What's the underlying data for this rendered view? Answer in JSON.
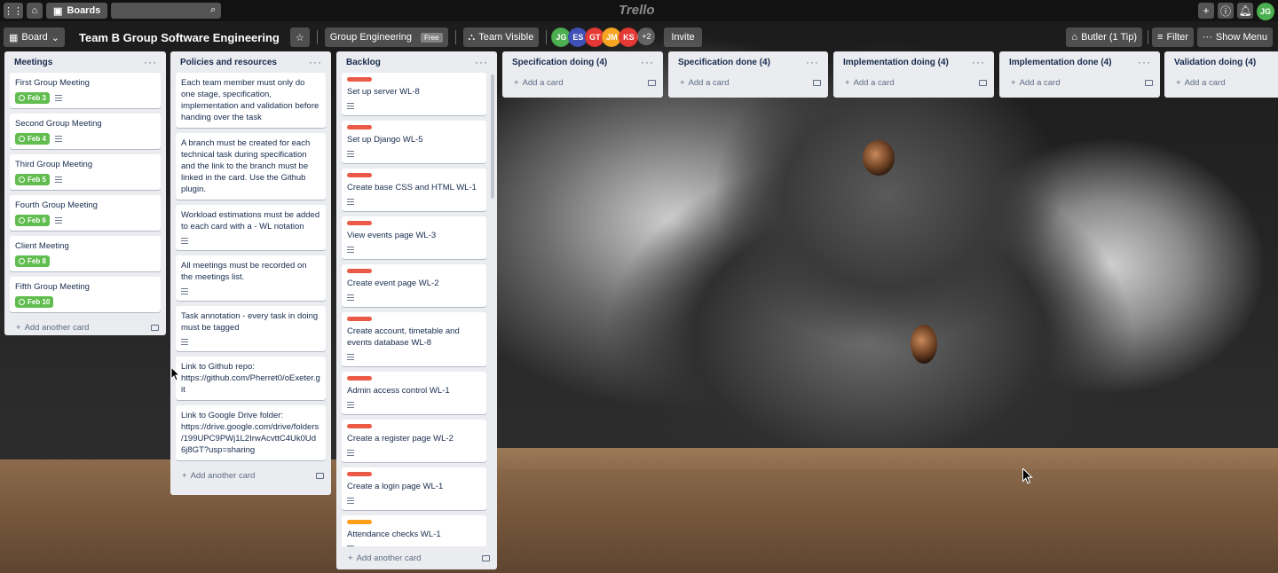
{
  "topbar": {
    "boards_label": "Boards",
    "logo": "Trello",
    "user_initials": "JG"
  },
  "header": {
    "view_label": "Board",
    "board_title": "Team B Group Software Engineering",
    "team_label": "Group Engineering",
    "team_plan": "Free",
    "visibility_label": "Team Visible",
    "members": [
      {
        "initials": "JG",
        "color": "#4caf50"
      },
      {
        "initials": "ES",
        "color": "#3f51b5"
      },
      {
        "initials": "GT",
        "color": "#e53935"
      },
      {
        "initials": "JM",
        "color": "#f6a623"
      },
      {
        "initials": "KS",
        "color": "#e53935"
      }
    ],
    "more_members": "+2",
    "invite_label": "Invite",
    "butler_label": "Butler (1 Tip)",
    "filter_label": "Filter",
    "show_menu_label": "Show Menu"
  },
  "lists": {
    "meetings": {
      "title": "Meetings",
      "add_label": "Add another card",
      "cards": [
        {
          "title": "First Group Meeting",
          "due": "Feb 3"
        },
        {
          "title": "Second Group Meeting",
          "due": "Feb 4"
        },
        {
          "title": "Third Group Meeting",
          "due": "Feb 5"
        },
        {
          "title": "Fourth Group Meeting",
          "due": "Feb 6"
        },
        {
          "title": "Client Meeting",
          "due": "Feb 8"
        },
        {
          "title": "Fifth Group Meeting",
          "due": "Feb 10"
        }
      ]
    },
    "policies": {
      "title": "Policies and resources",
      "add_label": "Add another card",
      "cards": [
        {
          "title": "Each team member must only do one stage, specification, implementation and validation before handing over the task"
        },
        {
          "title": "A branch must be created for each technical task during specification and the link to the branch must be linked in the card. Use the Github plugin."
        },
        {
          "title": "Workload estimations must be added to each card with a - WL notation"
        },
        {
          "title": "All meetings must be recorded on the meetings list."
        },
        {
          "title": "Task annotation - every task in doing must be tagged"
        },
        {
          "title": "Link to Github repo: https://github.com/Pherret0/oExeter.git"
        },
        {
          "title": "Link to Google Drive folder: https://drive.google.com/drive/folders/199UPC9PWj1L2IrwAcvttC4Uk0Ud6j8GT?usp=sharing"
        }
      ]
    },
    "backlog": {
      "title": "Backlog",
      "add_label": "Add another card",
      "cards": [
        {
          "title": "Set up server WL-8",
          "label_color": "#eb5a46"
        },
        {
          "title": "Set up Django WL-5",
          "label_color": "#eb5a46"
        },
        {
          "title": "Create base CSS and HTML WL-1",
          "label_color": "#eb5a46"
        },
        {
          "title": "View events page WL-3",
          "label_color": "#eb5a46"
        },
        {
          "title": "Create event page WL-2",
          "label_color": "#eb5a46"
        },
        {
          "title": "Create account, timetable and events database WL-8",
          "label_color": "#eb5a46"
        },
        {
          "title": "Admin access control WL-1",
          "label_color": "#eb5a46"
        },
        {
          "title": "Create a register page WL-2",
          "label_color": "#eb5a46"
        },
        {
          "title": "Create a login page WL-1",
          "label_color": "#eb5a46"
        },
        {
          "title": "Attendance checks WL-1",
          "label_color": "#ff9f1a"
        }
      ]
    },
    "spec_doing": {
      "title": "Specification doing (4)",
      "add_label": "Add a card"
    },
    "spec_done": {
      "title": "Specification done (4)",
      "add_label": "Add a card"
    },
    "impl_doing": {
      "title": "Implementation doing (4)",
      "add_label": "Add a card"
    },
    "impl_done": {
      "title": "Implementation done (4)",
      "add_label": "Add a card"
    },
    "valid_doing": {
      "title": "Validation doing (4)",
      "add_label": "Add a card"
    }
  }
}
